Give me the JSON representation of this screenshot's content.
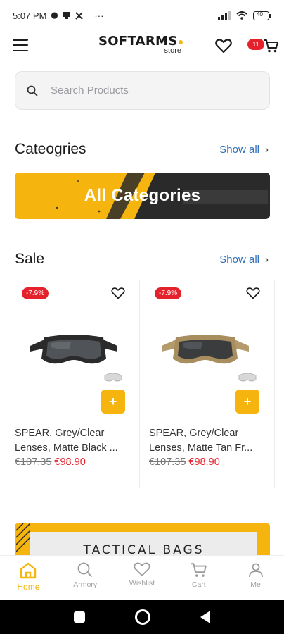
{
  "status_bar": {
    "time": "5:07 PM",
    "notif_icons": [
      "chat-bubble-icon",
      "message-icon",
      "x-icon"
    ],
    "more": "···",
    "battery": "40"
  },
  "header": {
    "logo_main": "SOFTARMS",
    "logo_sub": "store",
    "cart_count": "11",
    "icons": [
      "menu-icon",
      "heart-icon",
      "cart-icon"
    ]
  },
  "search": {
    "placeholder": "Search Products"
  },
  "categories": {
    "title": "Cateogries",
    "show_all": "Show all",
    "banner_label": "All Categories"
  },
  "sale": {
    "title": "Sale",
    "show_all": "Show all",
    "products": [
      {
        "discount": "-7.9%",
        "name_line1": "SPEAR, Grey/Clear",
        "name_line2": "Lenses, Matte Black ...",
        "old_price": "€107.35",
        "new_price": "€98.90",
        "frame_color": "#2b2b2b"
      },
      {
        "discount": "-7.9%",
        "name_line1": "SPEAR, Grey/Clear",
        "name_line2": "Lenses, Matte Tan Fr...",
        "old_price": "€107.35",
        "new_price": "€98.90",
        "frame_color": "#b59a6c"
      }
    ],
    "add_label": "+"
  },
  "promo": {
    "bags_label": "TACTICAL BAGS"
  },
  "bottom_nav": {
    "items": [
      {
        "label": "Home",
        "icon": "home-icon",
        "active": true
      },
      {
        "label": "Armory",
        "icon": "search-icon",
        "active": false
      },
      {
        "label": "Wishlist",
        "icon": "heart-icon",
        "active": false
      },
      {
        "label": "Cart",
        "icon": "cart-icon",
        "active": false
      },
      {
        "label": "Me",
        "icon": "person-icon",
        "active": false
      }
    ]
  },
  "colors": {
    "accent": "#f6b50e",
    "sale_red": "#e5222b",
    "link_blue": "#2c6fb7"
  }
}
